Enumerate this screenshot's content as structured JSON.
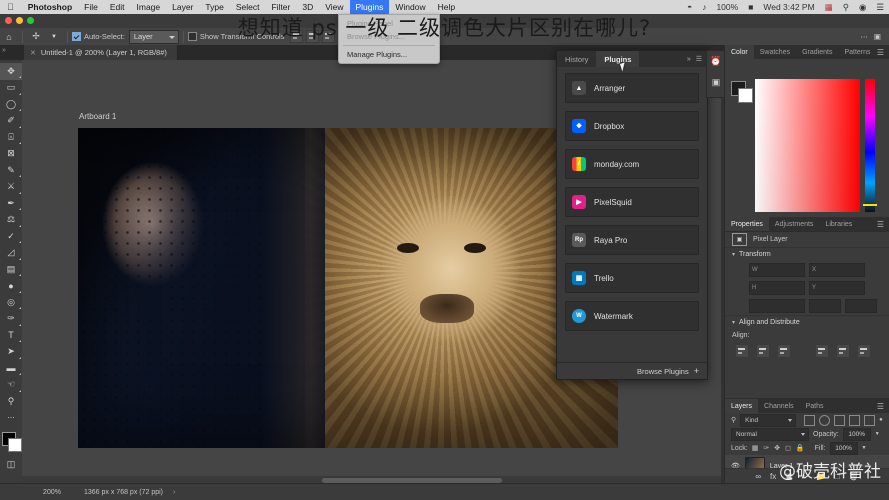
{
  "macos_menubar": {
    "apple_icon": "apple-icon",
    "app_name": "Photoshop",
    "menus": [
      "File",
      "Edit",
      "Image",
      "Layer",
      "Type",
      "Select",
      "Filter",
      "3D",
      "View",
      "Plugins",
      "Window",
      "Help"
    ],
    "active_menu": "Plugins",
    "status_items": [
      "wifi-icon",
      "volume-icon",
      "100%",
      "battery-icon"
    ],
    "clock": "Wed 3:42 PM",
    "right_icons": [
      "flag-icon",
      "search-icon",
      "siri-icon",
      "control-center-icon"
    ]
  },
  "plugins_menu": {
    "items": [
      "Plugins Panel",
      "Browse Plugins...",
      "Manage Plugins..."
    ],
    "highlighted": "Manage Plugins..."
  },
  "options_bar": {
    "tool_icon": "move-tool-icon",
    "move_icon": "move-arrows-icon",
    "auto_select_label": "Auto-Select:",
    "auto_select_checked": true,
    "auto_select_scope": "Layer",
    "show_transform_label": "Show Transform Controls",
    "show_transform_checked": false,
    "align_buttons": [
      "align-left-icon",
      "align-center-h-icon",
      "align-right-icon",
      "align-top-icon",
      "align-center-v-icon",
      "align-bottom-icon"
    ],
    "right_icons": [
      "more-options-icon",
      "3d-mode-icon"
    ]
  },
  "document_tab": {
    "close_icon": "close-icon",
    "title": "Untitled-1 @ 200% (Layer 1, RGB/8#)"
  },
  "toolbar": {
    "tools": [
      {
        "name": "move-tool",
        "glyph": "✥",
        "selected": true
      },
      {
        "name": "marquee-tool",
        "glyph": "▭",
        "selected": false
      },
      {
        "name": "lasso-tool",
        "glyph": "◯",
        "selected": false
      },
      {
        "name": "quick-selection-tool",
        "glyph": "✐",
        "selected": false
      },
      {
        "name": "crop-tool",
        "glyph": "⌗",
        "selected": false
      },
      {
        "name": "frame-tool",
        "glyph": "⊠",
        "selected": false
      },
      {
        "name": "eyedropper-tool",
        "glyph": "✎",
        "selected": false
      },
      {
        "name": "healing-brush-tool",
        "glyph": "⚕",
        "selected": false
      },
      {
        "name": "brush-tool",
        "glyph": "🖌",
        "selected": false
      },
      {
        "name": "clone-stamp-tool",
        "glyph": "⚒",
        "selected": false
      },
      {
        "name": "history-brush-tool",
        "glyph": "✒",
        "selected": false
      },
      {
        "name": "eraser-tool",
        "glyph": "◣",
        "selected": false
      },
      {
        "name": "gradient-tool",
        "glyph": "▤",
        "selected": false
      },
      {
        "name": "blur-tool",
        "glyph": "💧",
        "selected": false
      },
      {
        "name": "dodge-tool",
        "glyph": "◉",
        "selected": false
      },
      {
        "name": "pen-tool",
        "glyph": "✑",
        "selected": false
      },
      {
        "name": "type-tool",
        "glyph": "T",
        "selected": false
      },
      {
        "name": "path-selection-tool",
        "glyph": "➤",
        "selected": false
      },
      {
        "name": "rectangle-tool",
        "glyph": "▬",
        "selected": false
      },
      {
        "name": "hand-tool",
        "glyph": "✋",
        "selected": false
      },
      {
        "name": "zoom-tool",
        "glyph": "⚲",
        "selected": false
      },
      {
        "name": "edit-toolbar",
        "glyph": "•••",
        "selected": false
      }
    ],
    "foreground_color": "#000000",
    "background_color": "#ffffff",
    "quick_mask": "quick-mask-icon"
  },
  "canvas": {
    "artboard_label": "Artboard 1",
    "background_color": "#454545"
  },
  "plugins_panel": {
    "tabs": [
      {
        "label": "History",
        "active": false
      },
      {
        "label": "Plugins",
        "active": true
      }
    ],
    "collapse_icon": "chevron-double-right-icon",
    "menu_icon": "panel-menu-icon",
    "plugins": [
      {
        "name": "Arranger",
        "icon_color": "#4a4a4a",
        "icon_glyph": "▲"
      },
      {
        "name": "Dropbox",
        "icon_color": "#0061ff",
        "icon_glyph": "❖"
      },
      {
        "name": "monday.com",
        "icon_color": "#f2453d",
        "icon_glyph": "///"
      },
      {
        "name": "PixelSquid",
        "icon_color": "#e0218a",
        "icon_glyph": "▶"
      },
      {
        "name": "Raya Pro",
        "icon_color": "#5a5a5a",
        "icon_glyph": "Rp"
      },
      {
        "name": "Trello",
        "icon_color": "#0079bf",
        "icon_glyph": "▥"
      },
      {
        "name": "Watermark",
        "icon_color": "#1f9ad6",
        "icon_glyph": "W"
      }
    ],
    "footer_label": "Browse Plugins",
    "footer_plus": "+"
  },
  "color_panel": {
    "tabs": [
      {
        "label": "Color",
        "active": true
      },
      {
        "label": "Swatches",
        "active": false
      },
      {
        "label": "Gradients",
        "active": false
      },
      {
        "label": "Patterns",
        "active": false
      }
    ],
    "menu_icon": "panel-menu-icon",
    "foreground": "#1c1c1c",
    "background": "#ffffff"
  },
  "properties_panel": {
    "tabs": [
      {
        "label": "Properties",
        "active": true
      },
      {
        "label": "Adjustments",
        "active": false
      },
      {
        "label": "Libraries",
        "active": false
      }
    ],
    "menu_icon": "panel-menu-icon",
    "layer_type": "Pixel Layer",
    "layer_type_icon": "pixel-layer-icon",
    "sections": [
      {
        "title": "Transform"
      },
      {
        "title": "Align and Distribute"
      }
    ],
    "transform_fields": [
      {
        "tag": "W",
        "value": ""
      },
      {
        "tag": "X",
        "value": ""
      },
      {
        "tag": "H",
        "value": ""
      },
      {
        "tag": "Y",
        "value": ""
      }
    ],
    "angle_label": "",
    "align_label": "Align:",
    "align_buttons": [
      "align-left-icon",
      "align-center-h-icon",
      "align-right-icon",
      "align-top-icon",
      "align-middle-icon",
      "align-bottom-icon"
    ]
  },
  "layers_panel": {
    "tabs": [
      {
        "label": "Layers",
        "active": true
      },
      {
        "label": "Channels",
        "active": false
      },
      {
        "label": "Paths",
        "active": false
      }
    ],
    "menu_icon": "panel-menu-icon",
    "filter_label": "Kind",
    "filter_icon": "search-icon",
    "filter_type_icons": [
      "pixel-filter-icon",
      "adjustment-filter-icon",
      "type-filter-icon",
      "shape-filter-icon",
      "smart-object-filter-icon",
      "toggle-filter-icon"
    ],
    "blend_mode": "Normal",
    "opacity_label": "Opacity:",
    "opacity_value": "100%",
    "lock_label": "Lock:",
    "lock_icons": [
      "lock-transparent-icon",
      "lock-image-icon",
      "lock-position-icon",
      "lock-artboard-icon",
      "lock-all-icon"
    ],
    "fill_label": "Fill:",
    "fill_value": "100%",
    "layers": [
      {
        "name": "Layer 1",
        "visible": true,
        "thumb": "layer-thumbnail"
      }
    ],
    "bottom_icons": [
      "link-layers-icon",
      "layer-style-icon",
      "layer-mask-icon",
      "adjustment-layer-icon",
      "new-group-icon",
      "new-layer-icon",
      "delete-layer-icon"
    ]
  },
  "status_bar": {
    "zoom": "200%",
    "doc_size": "1366 px x 768 px (72 ppi)",
    "chevron": "›"
  },
  "overlays": {
    "title_text": "想知道 ps 一级 二级调色大片区别在哪儿?",
    "watermark_text": "@破壳科普社"
  }
}
